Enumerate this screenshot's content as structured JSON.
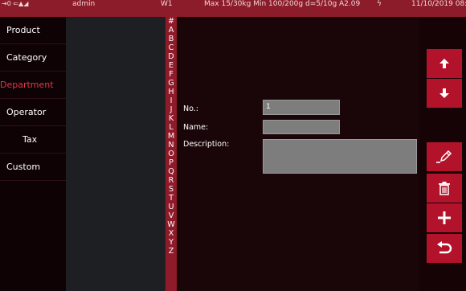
{
  "status_bar": {
    "icons_text": "⇥0 ⇐▲◢",
    "user": "admin",
    "station": "W1",
    "scale_info": "Max 15/30kg  Min 100/200g d=5/10g A2.09",
    "lightning": "ϟ",
    "datetime": "11/10/2019 08:3("
  },
  "sidebar": {
    "items": [
      {
        "label": "Product"
      },
      {
        "label": "Category"
      },
      {
        "label": "Department"
      },
      {
        "label": "Operator"
      },
      {
        "label": "Tax"
      },
      {
        "label": "Custom"
      }
    ],
    "active_item": "Department",
    "active_color": "#e0384a"
  },
  "alphabet_index": [
    "#",
    "A",
    "B",
    "C",
    "D",
    "E",
    "F",
    "G",
    "H",
    "I",
    "J",
    "K",
    "L",
    "M",
    "N",
    "O",
    "P",
    "Q",
    "R",
    "S",
    "T",
    "U",
    "V",
    "W",
    "X",
    "Y",
    "Z"
  ],
  "form": {
    "no_label": "No.:",
    "no_value": "1",
    "name_label": "Name:",
    "name_value": "",
    "description_label": "Description:",
    "description_value": ""
  },
  "actions": {
    "move_up_icon": "arrow-up-icon",
    "move_down_icon": "arrow-down-icon",
    "edit_icon": "pencil-icon",
    "delete_icon": "trash-icon",
    "add_icon": "plus-icon",
    "back_icon": "return-icon",
    "button_color": "#b3122b"
  },
  "colors": {
    "status_bar": "#8c1c2a",
    "alphabet_bar": "#8f1a2a",
    "background": "#1a0508",
    "list_pane": "#1e1f22",
    "field": "#7d7d7d"
  }
}
